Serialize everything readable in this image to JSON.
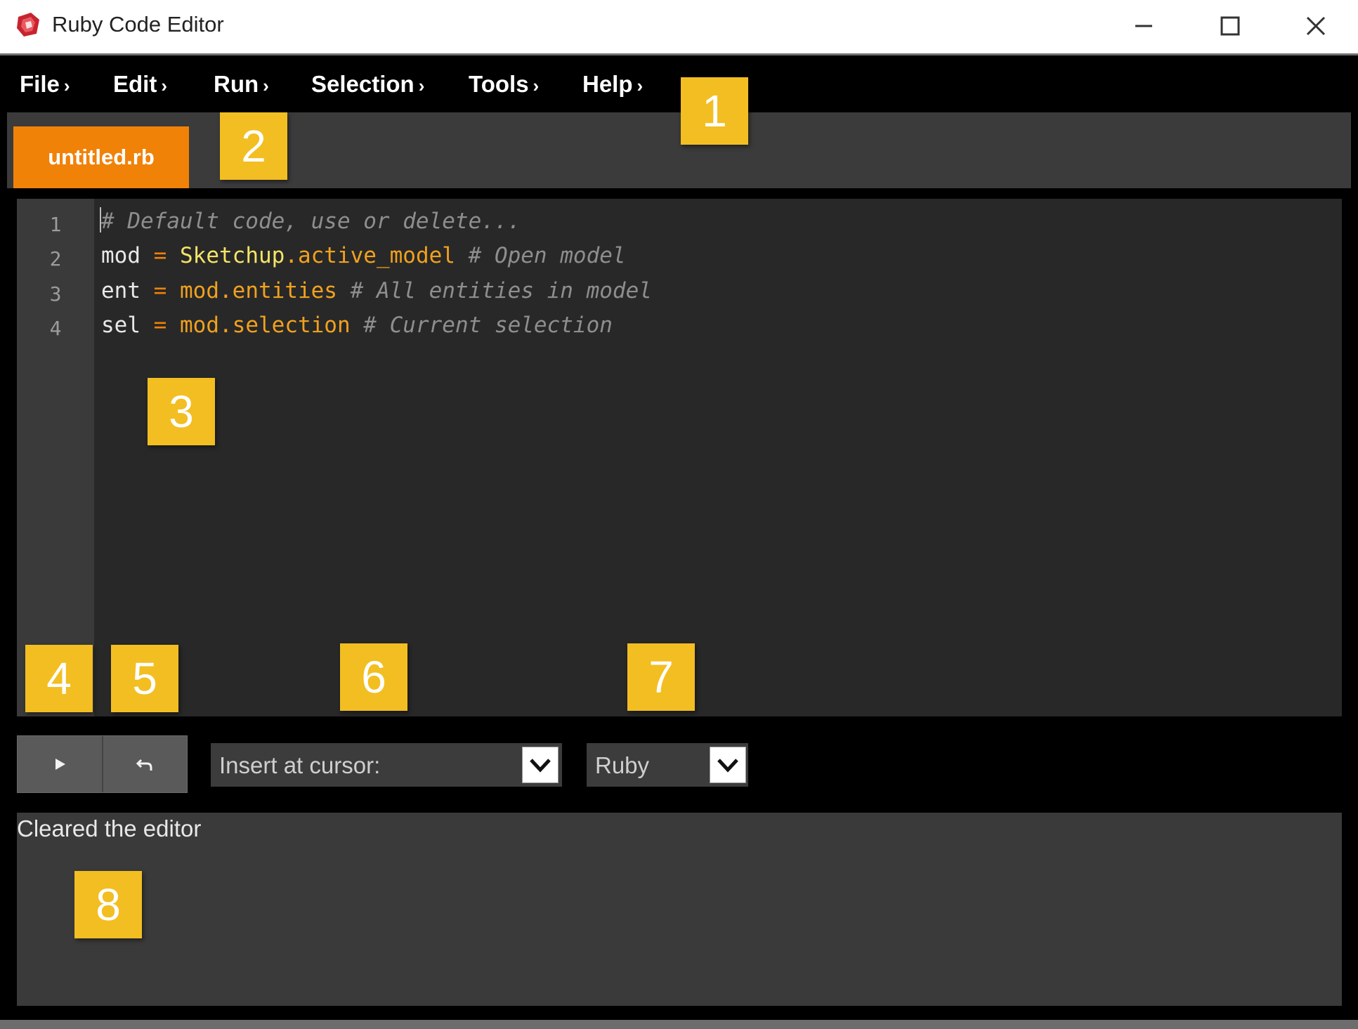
{
  "window": {
    "title": "Ruby Code Editor",
    "icon": "sketchup-ruby-icon",
    "controls": [
      "minimize-icon",
      "maximize-icon",
      "close-icon"
    ]
  },
  "menu": {
    "items": [
      {
        "label": "File",
        "chevron": "›"
      },
      {
        "label": "Edit",
        "chevron": "›"
      },
      {
        "label": "Run",
        "chevron": "›"
      },
      {
        "label": "Selection",
        "chevron": "›"
      },
      {
        "label": "Tools",
        "chevron": "›"
      },
      {
        "label": "Help",
        "chevron": "›"
      }
    ]
  },
  "tabs": [
    {
      "label": "untitled.rb",
      "active": true
    }
  ],
  "editor": {
    "line_numbers": [
      "1",
      "2",
      "3",
      "4"
    ],
    "lines": [
      {
        "comment": "# Default code, use or delete..."
      },
      {
        "var": "mod",
        "op": " = ",
        "obj": "Sketchup",
        "method": ".active_model",
        "comment": " # Open model"
      },
      {
        "var": "ent",
        "op": " = ",
        "obj": "mod",
        "method": ".entities",
        "comment": " # All entities in model"
      },
      {
        "var": "sel",
        "op": " = ",
        "obj": "mod",
        "method": ".selection",
        "comment": " # Current selection"
      }
    ]
  },
  "toolbar": {
    "run_icon": "play-icon",
    "undo_icon": "undo-icon",
    "insert_select_value": "Insert at cursor:",
    "language_select_value": "Ruby"
  },
  "output": {
    "text": "Cleared the editor"
  },
  "callouts": [
    "1",
    "2",
    "3",
    "4",
    "5",
    "6",
    "7",
    "8"
  ],
  "colors": {
    "accent_orange": "#f08208",
    "callout_yellow": "#f2be22",
    "editor_bg": "#282828",
    "panel_bg": "#3a3a3a",
    "constant_yellow": "#f3e468",
    "comment_gray": "#8e8e8e"
  }
}
